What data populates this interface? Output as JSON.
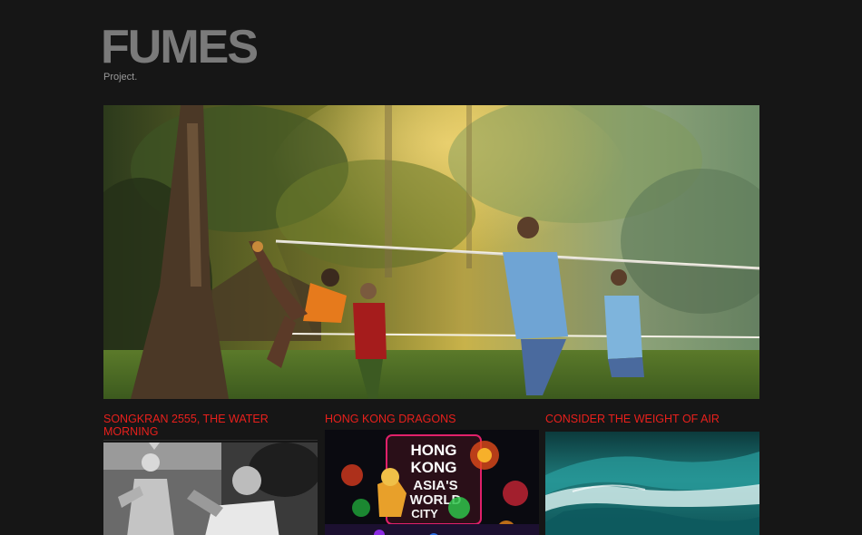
{
  "site": {
    "logo": "FUMES",
    "tagline": "Project."
  },
  "hero": {
    "alt_icon": "photo-sepak-takraw-match"
  },
  "posts": [
    {
      "title": "SONGKRAN 2555, THE WATER MORNING",
      "icon": "photo-buddha-statue"
    },
    {
      "title": "HONG KONG DRAGONS",
      "icon": "photo-hong-kong-neon-sign"
    },
    {
      "title": "CONSIDER THE WEIGHT OF AIR",
      "icon": "photo-ocean-wave"
    }
  ],
  "thumb_texts": {
    "hong_kong_sign_line1": "HONG",
    "hong_kong_sign_line2": "KONG",
    "hong_kong_sign_line3": "ASIA'S",
    "hong_kong_sign_line4": "WORLD",
    "hong_kong_sign_line5": "CITY"
  },
  "colors": {
    "background": "#161616",
    "logo": "#7a7a7a",
    "post_title": "#e8201c"
  }
}
